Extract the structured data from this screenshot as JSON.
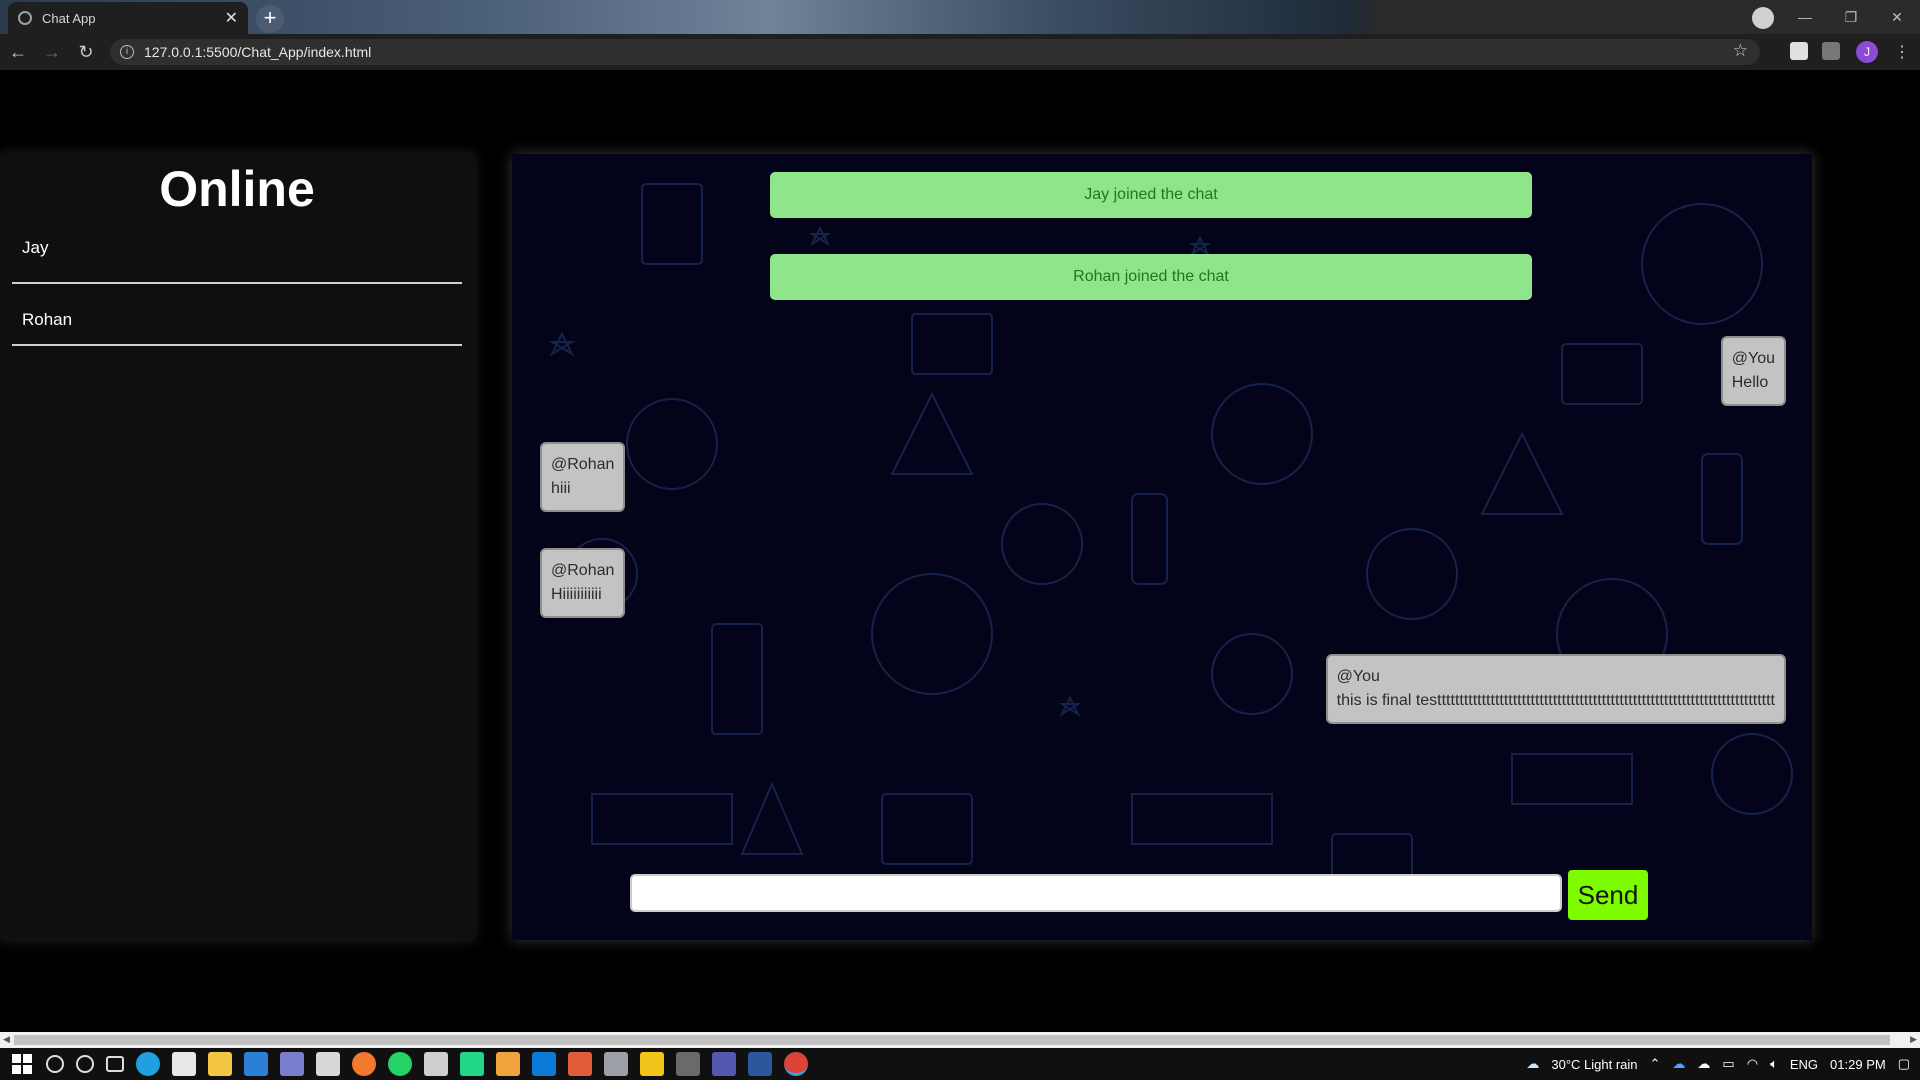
{
  "browser": {
    "tab_title": "Chat App",
    "url": "127.0.0.1:5500/Chat_App/index.html",
    "profile_initial": "J"
  },
  "sidebar": {
    "title": "Online",
    "users": [
      {
        "name": "Jay"
      },
      {
        "name": "Rohan"
      }
    ]
  },
  "chat": {
    "notices": [
      {
        "text": "Jay joined the chat"
      },
      {
        "text": "Rohan joined the chat"
      }
    ],
    "messages": [
      {
        "side": "right",
        "sender": "@You",
        "text": "Hello"
      },
      {
        "side": "left",
        "sender": "@Rohan",
        "text": "hiii"
      },
      {
        "side": "left",
        "sender": "@Rohan",
        "text": "Hiiiiiiiiiii"
      },
      {
        "side": "right",
        "sender": "@You",
        "text": "this is final testttttttttttttttttttttttttttttttttttttttttttttttttttttttttttttttttttttttttttt"
      }
    ],
    "input_value": "",
    "send_label": "Send"
  },
  "taskbar": {
    "weather": "30°C  Light rain",
    "lang": "ENG",
    "time": "01:29 PM"
  },
  "colors": {
    "notice_bg": "#8ee58a",
    "send_bg": "#7dfc00",
    "chat_bg": "#03041a",
    "bubble_bg": "#c3c3c3"
  }
}
